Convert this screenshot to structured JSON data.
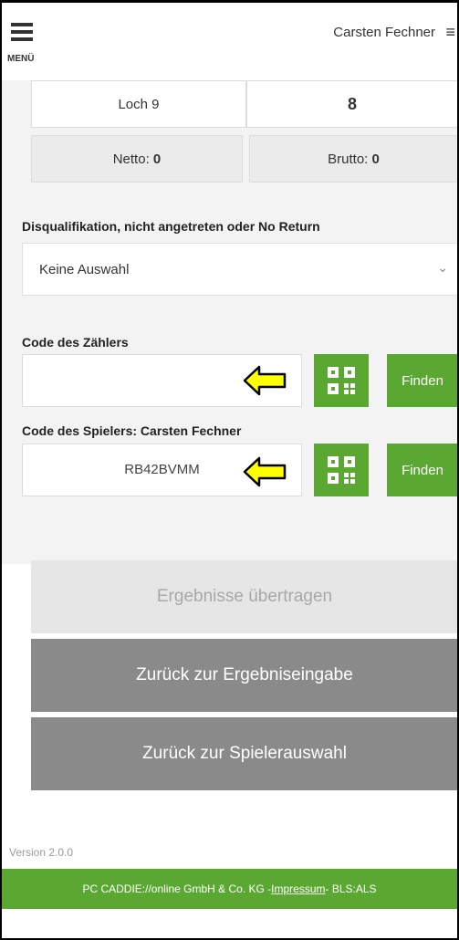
{
  "header": {
    "menu_label": "MENÜ",
    "user_name": "Carsten Fechner",
    "user_menu_icon": "≡"
  },
  "score": {
    "hole_label": "Loch 9",
    "hole_value": "8",
    "netto_label": "Netto: ",
    "netto_value": "0",
    "brutto_label": "Brutto: ",
    "brutto_value": "0"
  },
  "disq": {
    "label": "Disqualifikation, nicht angetreten oder No Return",
    "selected": "Keine Auswahl",
    "chevron": "⌄"
  },
  "marker_code": {
    "label": "Code des Zählers",
    "value": "",
    "find_label": "Finden"
  },
  "player_code": {
    "label": "Code des Spielers: Carsten Fechner",
    "value": "RB42BVMM",
    "find_label": "Finden"
  },
  "actions": {
    "submit": "Ergebnisse übertragen",
    "back_to_entry": "Zurück zur Ergebniseingabe",
    "back_to_players": "Zurück zur Spielerauswahl"
  },
  "version": "Version 2.0.0",
  "footer": {
    "company": "PC CADDIE://online GmbH & Co. KG - ",
    "impressum": "Impressum",
    "suffix": " - BLS:ALS"
  },
  "colors": {
    "accent_green": "#5aa832",
    "arrow_yellow": "#ffff00",
    "button_grey": "#8a8a8a"
  }
}
